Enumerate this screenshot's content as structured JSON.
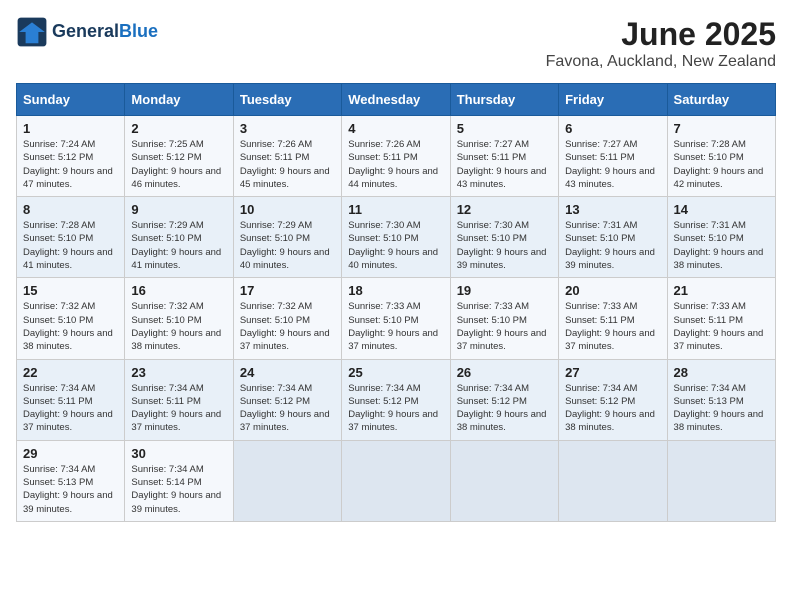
{
  "logo": {
    "general": "General",
    "blue": "Blue"
  },
  "title": "June 2025",
  "subtitle": "Favona, Auckland, New Zealand",
  "weekdays": [
    "Sunday",
    "Monday",
    "Tuesday",
    "Wednesday",
    "Thursday",
    "Friday",
    "Saturday"
  ],
  "weeks": [
    [
      {
        "day": "1",
        "sunrise": "7:24 AM",
        "sunset": "5:12 PM",
        "daylight": "9 hours and 47 minutes."
      },
      {
        "day": "2",
        "sunrise": "7:25 AM",
        "sunset": "5:12 PM",
        "daylight": "9 hours and 46 minutes."
      },
      {
        "day": "3",
        "sunrise": "7:26 AM",
        "sunset": "5:11 PM",
        "daylight": "9 hours and 45 minutes."
      },
      {
        "day": "4",
        "sunrise": "7:26 AM",
        "sunset": "5:11 PM",
        "daylight": "9 hours and 44 minutes."
      },
      {
        "day": "5",
        "sunrise": "7:27 AM",
        "sunset": "5:11 PM",
        "daylight": "9 hours and 43 minutes."
      },
      {
        "day": "6",
        "sunrise": "7:27 AM",
        "sunset": "5:11 PM",
        "daylight": "9 hours and 43 minutes."
      },
      {
        "day": "7",
        "sunrise": "7:28 AM",
        "sunset": "5:10 PM",
        "daylight": "9 hours and 42 minutes."
      }
    ],
    [
      {
        "day": "8",
        "sunrise": "7:28 AM",
        "sunset": "5:10 PM",
        "daylight": "9 hours and 41 minutes."
      },
      {
        "day": "9",
        "sunrise": "7:29 AM",
        "sunset": "5:10 PM",
        "daylight": "9 hours and 41 minutes."
      },
      {
        "day": "10",
        "sunrise": "7:29 AM",
        "sunset": "5:10 PM",
        "daylight": "9 hours and 40 minutes."
      },
      {
        "day": "11",
        "sunrise": "7:30 AM",
        "sunset": "5:10 PM",
        "daylight": "9 hours and 40 minutes."
      },
      {
        "day": "12",
        "sunrise": "7:30 AM",
        "sunset": "5:10 PM",
        "daylight": "9 hours and 39 minutes."
      },
      {
        "day": "13",
        "sunrise": "7:31 AM",
        "sunset": "5:10 PM",
        "daylight": "9 hours and 39 minutes."
      },
      {
        "day": "14",
        "sunrise": "7:31 AM",
        "sunset": "5:10 PM",
        "daylight": "9 hours and 38 minutes."
      }
    ],
    [
      {
        "day": "15",
        "sunrise": "7:32 AM",
        "sunset": "5:10 PM",
        "daylight": "9 hours and 38 minutes."
      },
      {
        "day": "16",
        "sunrise": "7:32 AM",
        "sunset": "5:10 PM",
        "daylight": "9 hours and 38 minutes."
      },
      {
        "day": "17",
        "sunrise": "7:32 AM",
        "sunset": "5:10 PM",
        "daylight": "9 hours and 37 minutes."
      },
      {
        "day": "18",
        "sunrise": "7:33 AM",
        "sunset": "5:10 PM",
        "daylight": "9 hours and 37 minutes."
      },
      {
        "day": "19",
        "sunrise": "7:33 AM",
        "sunset": "5:10 PM",
        "daylight": "9 hours and 37 minutes."
      },
      {
        "day": "20",
        "sunrise": "7:33 AM",
        "sunset": "5:11 PM",
        "daylight": "9 hours and 37 minutes."
      },
      {
        "day": "21",
        "sunrise": "7:33 AM",
        "sunset": "5:11 PM",
        "daylight": "9 hours and 37 minutes."
      }
    ],
    [
      {
        "day": "22",
        "sunrise": "7:34 AM",
        "sunset": "5:11 PM",
        "daylight": "9 hours and 37 minutes."
      },
      {
        "day": "23",
        "sunrise": "7:34 AM",
        "sunset": "5:11 PM",
        "daylight": "9 hours and 37 minutes."
      },
      {
        "day": "24",
        "sunrise": "7:34 AM",
        "sunset": "5:12 PM",
        "daylight": "9 hours and 37 minutes."
      },
      {
        "day": "25",
        "sunrise": "7:34 AM",
        "sunset": "5:12 PM",
        "daylight": "9 hours and 37 minutes."
      },
      {
        "day": "26",
        "sunrise": "7:34 AM",
        "sunset": "5:12 PM",
        "daylight": "9 hours and 38 minutes."
      },
      {
        "day": "27",
        "sunrise": "7:34 AM",
        "sunset": "5:12 PM",
        "daylight": "9 hours and 38 minutes."
      },
      {
        "day": "28",
        "sunrise": "7:34 AM",
        "sunset": "5:13 PM",
        "daylight": "9 hours and 38 minutes."
      }
    ],
    [
      {
        "day": "29",
        "sunrise": "7:34 AM",
        "sunset": "5:13 PM",
        "daylight": "9 hours and 39 minutes."
      },
      {
        "day": "30",
        "sunrise": "7:34 AM",
        "sunset": "5:14 PM",
        "daylight": "9 hours and 39 minutes."
      },
      null,
      null,
      null,
      null,
      null
    ]
  ]
}
